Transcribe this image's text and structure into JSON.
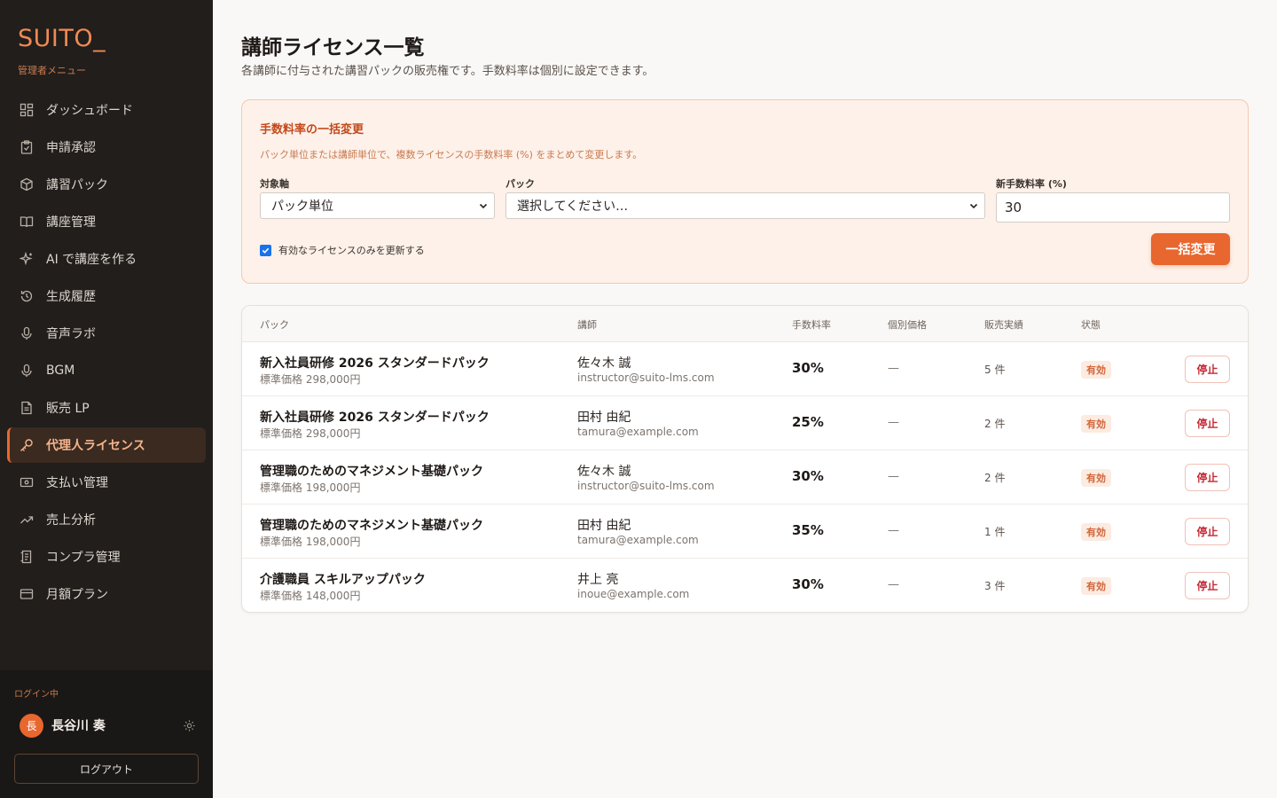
{
  "sidebar": {
    "brand": "SUITO_",
    "subtitle": "管理者メニュー",
    "items": [
      {
        "label": "ダッシュボード",
        "icon": "dashboard-icon"
      },
      {
        "label": "申請承認",
        "icon": "clipboard-icon"
      },
      {
        "label": "講習パック",
        "icon": "package-icon"
      },
      {
        "label": "講座管理",
        "icon": "book-icon"
      },
      {
        "label": "AI で講座を作る",
        "icon": "sparkle-icon"
      },
      {
        "label": "生成履歴",
        "icon": "history-icon"
      },
      {
        "label": "音声ラボ",
        "icon": "microphone-icon"
      },
      {
        "label": "BGM",
        "icon": "microphone-icon"
      },
      {
        "label": "販売 LP",
        "icon": "document-icon"
      },
      {
        "label": "代理人ライセンス",
        "icon": "key-icon",
        "active": true
      },
      {
        "label": "支払い管理",
        "icon": "payment-icon"
      },
      {
        "label": "売上分析",
        "icon": "trend-icon"
      },
      {
        "label": "コンプラ管理",
        "icon": "compliance-icon"
      },
      {
        "label": "月額プラン",
        "icon": "card-icon"
      }
    ],
    "login_label": "ログイン中",
    "user_initial": "長",
    "user_name": "長谷川 奏",
    "logout_label": "ログアウト"
  },
  "header": {
    "title": "講師ライセンス一覧",
    "description": "各講師に付与された講習パックの販売権です。手数料率は個別に設定できます。"
  },
  "bulk": {
    "title": "手数料率の一括変更",
    "description": "パック単位または講師単位で、複数ライセンスの手数料率 (%) をまとめて変更します。",
    "axis_label": "対象軸",
    "axis_value": "パック単位",
    "pack_label": "パック",
    "pack_value": "選択してください…",
    "rate_label": "新手数料率 (%)",
    "rate_value": "30",
    "only_active_label": "有効なライセンスのみを更新する",
    "only_active_checked": true,
    "submit_label": "一括変更"
  },
  "table": {
    "headers": {
      "pack": "パック",
      "instructor": "講師",
      "rate": "手数料率",
      "indiv_price": "個別価格",
      "sales": "販売実績",
      "status": "状態"
    },
    "rows": [
      {
        "pack": "新入社員研修 2026 スタンダードパック",
        "price": "標準価格 298,000円",
        "instructor": "佐々木 誠",
        "email": "instructor@suito-lms.com",
        "rate": "30%",
        "indiv": "—",
        "sales": "5 件",
        "status": "有効",
        "action": "停止"
      },
      {
        "pack": "新入社員研修 2026 スタンダードパック",
        "price": "標準価格 298,000円",
        "instructor": "田村 由紀",
        "email": "tamura@example.com",
        "rate": "25%",
        "indiv": "—",
        "sales": "2 件",
        "status": "有効",
        "action": "停止"
      },
      {
        "pack": "管理職のためのマネジメント基礎パック",
        "price": "標準価格 198,000円",
        "instructor": "佐々木 誠",
        "email": "instructor@suito-lms.com",
        "rate": "30%",
        "indiv": "—",
        "sales": "2 件",
        "status": "有効",
        "action": "停止"
      },
      {
        "pack": "管理職のためのマネジメント基礎パック",
        "price": "標準価格 198,000円",
        "instructor": "田村 由紀",
        "email": "tamura@example.com",
        "rate": "35%",
        "indiv": "—",
        "sales": "1 件",
        "status": "有効",
        "action": "停止"
      },
      {
        "pack": "介護職員 スキルアップパック",
        "price": "標準価格 148,000円",
        "instructor": "井上 亮",
        "email": "inoue@example.com",
        "rate": "30%",
        "indiv": "—",
        "sales": "3 件",
        "status": "有効",
        "action": "停止"
      }
    ]
  },
  "colors": {
    "accent": "#e8672e",
    "sidebar_bg": "#211e1b",
    "danger": "#c42a36"
  }
}
